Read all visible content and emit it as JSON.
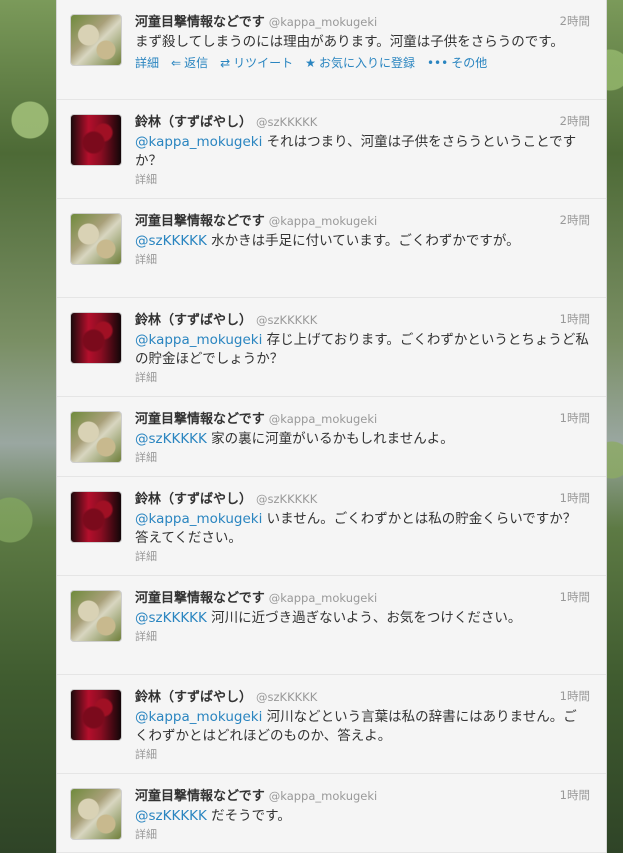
{
  "tweets": [
    {
      "avatar": "kappa",
      "name": "河童目撃情報などです",
      "handle": "@kappa_mokugeki",
      "time": "2時間",
      "mention": "",
      "text": "まず殺してしまうのには理由があります。河童は子供をさらうのです。",
      "details": "詳細",
      "expanded": true,
      "actions": {
        "reply": "返信",
        "retweet": "リツイート",
        "favorite": "お気に入りに登録",
        "more": "その他"
      },
      "height": 100
    },
    {
      "avatar": "suzu",
      "name": "鈴林（すずばやし）",
      "handle": "@szKKKKK",
      "time": "2時間",
      "mention": "@kappa_mokugeki",
      "text": " それはつまり、河童は子供をさらうということですか？",
      "details": "詳細",
      "height": 99
    },
    {
      "avatar": "kappa",
      "name": "河童目撃情報などです",
      "handle": "@kappa_mokugeki",
      "time": "2時間",
      "mention": "@szKKKKK",
      "text": " 水かきは手足に付いています。ごくわずかですが。",
      "details": "詳細",
      "height": 99
    },
    {
      "avatar": "suzu",
      "name": "鈴林（すずばやし）",
      "handle": "@szKKKKK",
      "time": "1時間",
      "mention": "@kappa_mokugeki",
      "text": " 存じ上げております。ごくわずかというとちょうど私の貯金ほどでしょうか？",
      "details": "詳細",
      "height": 99
    },
    {
      "avatar": "kappa",
      "name": "河童目撃情報などです",
      "handle": "@kappa_mokugeki",
      "time": "1時間",
      "mention": "@szKKKKK",
      "text": " 家の裏に河童がいるかもしれませんよ。",
      "details": "詳細",
      "height": 80
    },
    {
      "avatar": "suzu",
      "name": "鈴林（すずばやし）",
      "handle": "@szKKKKK",
      "time": "1時間",
      "mention": "@kappa_mokugeki",
      "text": " いません。ごくわずかとは私の貯金くらいですか？ 答えてください。",
      "details": "詳細",
      "height": 99
    },
    {
      "avatar": "kappa",
      "name": "河童目撃情報などです",
      "handle": "@kappa_mokugeki",
      "time": "1時間",
      "mention": "@szKKKKK",
      "text": " 河川に近づき過ぎないよう、お気をつけください。",
      "details": "詳細",
      "height": 99
    },
    {
      "avatar": "suzu",
      "name": "鈴林（すずばやし）",
      "handle": "@szKKKKK",
      "time": "1時間",
      "mention": "@kappa_mokugeki",
      "text": " 河川などという言葉は私の辞書にはありません。ごくわずかとはどれほどのものか、答えよ。",
      "details": "詳細",
      "height": 99
    },
    {
      "avatar": "kappa",
      "name": "河童目撃情報などです",
      "handle": "@kappa_mokugeki",
      "time": "1時間",
      "mention": "@szKKKKK",
      "text": " だそうです。",
      "details": "詳細",
      "height": 79
    }
  ],
  "colors": {
    "link": "#2a85c0",
    "muted": "#999999",
    "text": "#333333"
  }
}
